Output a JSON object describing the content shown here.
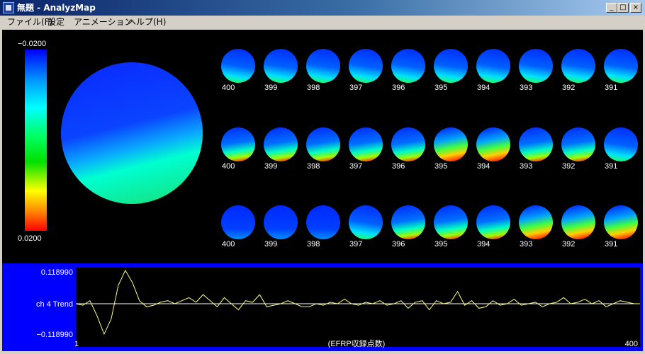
{
  "window": {
    "title": "無題 - AnalyzMap",
    "controls": {
      "minimize": "_",
      "maximize": "□",
      "close": "×"
    }
  },
  "menu": {
    "items": [
      "ファイル(F)",
      "設定",
      "アニメーション",
      "ヘルプ(H)"
    ]
  },
  "colors": {
    "canvas_bg": "#000000",
    "trend_bg": "#0000ff",
    "trend_plot_bg": "#000000",
    "trend_line": "#ffff80",
    "baseline": "#ffffff"
  },
  "color_scale": {
    "max_label": "−0.0200",
    "min_label": "0.0200",
    "stops": [
      "#0000ff",
      "#00a0ff",
      "#00ffff",
      "#00ff60",
      "#00ff00",
      "#ffff00",
      "#ff8000",
      "#ff0000"
    ]
  },
  "maps": {
    "labels": [
      "400",
      "399",
      "398",
      "397",
      "396",
      "395",
      "394",
      "393",
      "392",
      "391"
    ]
  },
  "trend": {
    "y_max_label": "0.118990",
    "y_mid_label": "ch 4  Trend",
    "y_min_label": "−0.118990",
    "x_start_label": "1",
    "x_end_label": "400",
    "x_label": "(EFRP収録点数)"
  },
  "chart_data": {
    "type": "line",
    "title": "",
    "xlabel": "(EFRP収録点数)",
    "ylabel": "ch 4  Trend",
    "xlim": [
      1,
      400
    ],
    "ylim": [
      -0.11899,
      0.11899
    ],
    "series": [
      {
        "x": [
          1,
          6,
          11,
          16,
          21,
          26,
          31,
          36,
          41,
          46,
          51,
          56,
          61,
          66,
          71,
          76,
          81,
          86,
          91,
          96,
          101,
          106,
          111,
          116,
          121,
          126,
          131,
          136,
          141,
          146,
          151,
          156,
          161,
          166,
          171,
          176,
          181,
          186,
          191,
          196,
          201,
          206,
          211,
          216,
          221,
          226,
          231,
          236,
          241,
          246,
          251,
          256,
          261,
          266,
          271,
          276,
          281,
          286,
          291,
          296,
          301,
          306,
          311,
          316,
          321,
          326,
          331,
          336,
          341,
          346,
          351,
          356,
          361,
          366,
          371,
          376,
          381,
          386,
          391,
          396,
          400
        ],
        "values": [
          0,
          -0.005,
          0.01,
          -0.04,
          -0.1,
          -0.05,
          0.06,
          0.11,
          0.07,
          0.01,
          -0.01,
          -0.005,
          0.005,
          0.01,
          0.0,
          0.01,
          0.02,
          0.005,
          0.03,
          0.01,
          -0.01,
          0.02,
          0.0,
          -0.02,
          0.01,
          0.005,
          0.03,
          -0.01,
          -0.005,
          0.0,
          0.01,
          0.0,
          -0.01,
          -0.01,
          0.0,
          -0.005,
          0.005,
          0.0,
          0.015,
          0.0,
          -0.005,
          0.005,
          0.0,
          0.01,
          -0.005,
          0.0,
          0.01,
          -0.015,
          0.005,
          0.01,
          -0.02,
          0.01,
          0.0,
          0.005,
          0.04,
          -0.005,
          0.01,
          -0.015,
          -0.01,
          0.01,
          -0.005,
          0.0,
          0.015,
          -0.005,
          0.0,
          0.005,
          -0.01,
          0.0,
          0.005,
          0.02,
          0.0,
          0.005,
          0.015,
          0.0,
          0.01,
          -0.01,
          0.0,
          0.01,
          0.005,
          0.0,
          0.0
        ]
      }
    ]
  }
}
